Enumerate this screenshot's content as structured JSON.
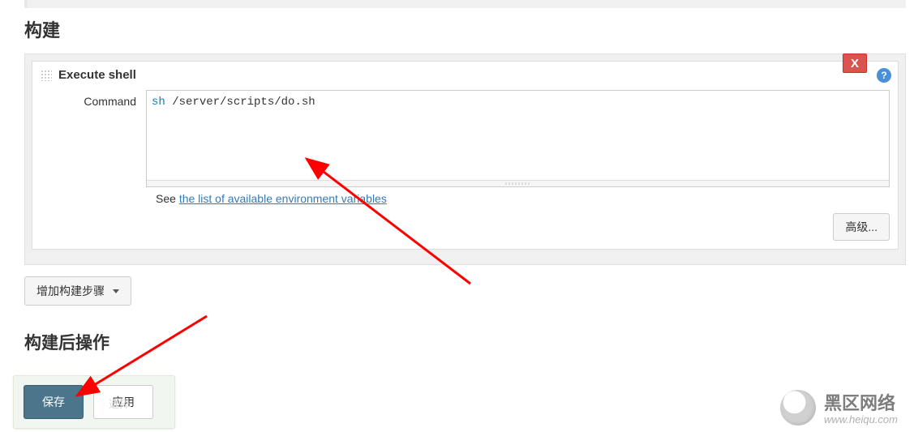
{
  "section_build_title": "构建",
  "build_step": {
    "title": "Execute shell",
    "close_label": "X",
    "help_label": "?",
    "command_label": "Command",
    "command_value_kw": "sh",
    "command_value_path": " /server/scripts/do.sh",
    "hint_prefix": "See ",
    "hint_link_text": "the list of available environment variables",
    "advanced_btn": "高级..."
  },
  "add_step_btn": "增加构建步骤",
  "section_post_title": "构建后操作",
  "footer": {
    "save_btn": "保存",
    "apply_btn": "应用",
    "ghost": "选择"
  },
  "watermark": {
    "cn": "黑区网络",
    "en": "www.heiqu.com"
  }
}
